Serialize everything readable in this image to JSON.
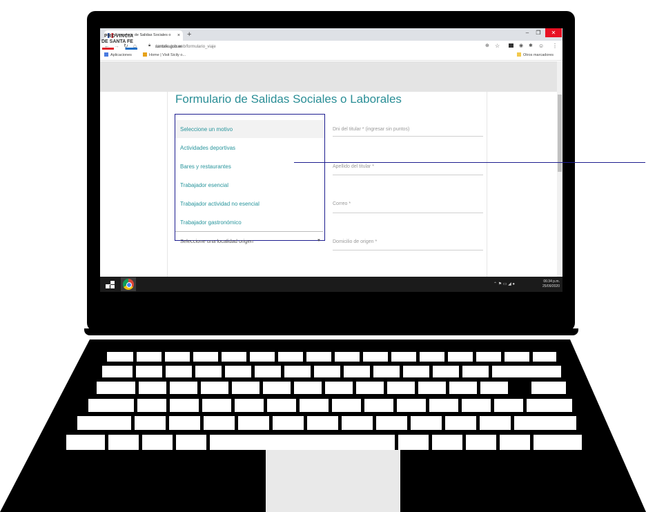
{
  "browser": {
    "tab_title": "Formulario de Salidas Sociales o",
    "new_tab": "+",
    "close_tab": "×",
    "url_domain": "santafe.gob.ar",
    "url_path": "/coronavirusweb/formulario_viaje",
    "bookmarks": [
      "Aplicaciones",
      "Home | Visit Sicily o...",
      "Otros marcadores"
    ]
  },
  "site": {
    "logo_line1": "PROVINCIA",
    "logo_line2": "DE SANTA FE",
    "form_title": "Formulario de Salidas Sociales o Laborales"
  },
  "motivo_dropdown": {
    "options": [
      "Seleccione un motivo",
      "Actividades deportivas",
      "Bares y restaurantes",
      "Trabajador esencial",
      "Trabajador actividad no esencial",
      "Trabajador gastronómico"
    ]
  },
  "localidad_select": {
    "placeholder": "Seleccione una localidad origen",
    "caret": "▼"
  },
  "fields": [
    "Dni del titular * (ingresar sin puntos)",
    "Apellido del titular *",
    "Correo *",
    "Domicilio de origen *"
  ],
  "taskbar": {
    "time": "06:34 p.m.",
    "date": "25/09/2020"
  },
  "colors": {
    "accent_teal": "#2a8e96",
    "callout_blue": "#1c1c8f",
    "window_close_red": "#e81123"
  },
  "icons": [
    "windows-start-icon",
    "chrome-icon",
    "lock-icon",
    "star-icon",
    "zoom-icon",
    "menu-dots-icon"
  ]
}
